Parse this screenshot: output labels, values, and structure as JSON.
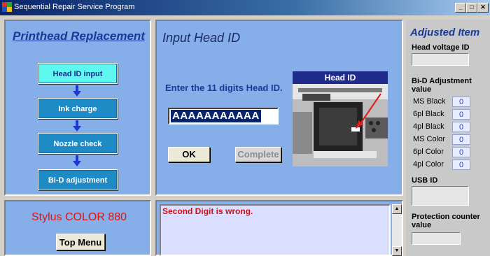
{
  "window": {
    "title": "Sequential Repair Service Program",
    "controls": {
      "minimize": "_",
      "maximize": "□",
      "close": "✕"
    }
  },
  "left": {
    "heading": "Printhead Replacement",
    "steps": [
      {
        "label": "Head ID input",
        "active": true
      },
      {
        "label": "Ink charge",
        "active": false
      },
      {
        "label": "Nozzle check",
        "active": false
      },
      {
        "label": "Bi-D adjustment",
        "active": false
      }
    ],
    "model": "Stylus COLOR 880",
    "top_menu_label": "Top Menu"
  },
  "center": {
    "heading": "Input Head ID",
    "prompt": "Enter the 11 digits Head ID.",
    "head_id_value": "AAAAAAAAAAA",
    "ok_label": "OK",
    "complete_label": "Complete",
    "photo_caption": "Head ID",
    "message": "Second Digit is wrong."
  },
  "right": {
    "heading": "Adjusted Item",
    "head_voltage_label": "Head voltage ID",
    "head_voltage_value": "",
    "bid_label": "Bi-D Adjustment value",
    "bid_rows": [
      {
        "label": "MS Black",
        "value": "0"
      },
      {
        "label": "6pl Black",
        "value": "0"
      },
      {
        "label": "4pl Black",
        "value": "0"
      },
      {
        "label": "MS Color",
        "value": "0"
      },
      {
        "label": "6pl Color",
        "value": "0"
      },
      {
        "label": "4pl Color",
        "value": "0"
      }
    ],
    "usb_label": "USB ID",
    "usb_value": "",
    "protection_label": "Protection counter value",
    "protection_value": ""
  },
  "colors": {
    "panel_blue": "#86aee8",
    "step_active": "#5ff8f0",
    "step_inactive": "#1f8bc6",
    "error_red": "#d41010",
    "title_blue": "#1a3a9a"
  },
  "icons": [
    "app-icon",
    "down-arrow-icon",
    "scroll-up-icon",
    "scroll-down-icon"
  ]
}
